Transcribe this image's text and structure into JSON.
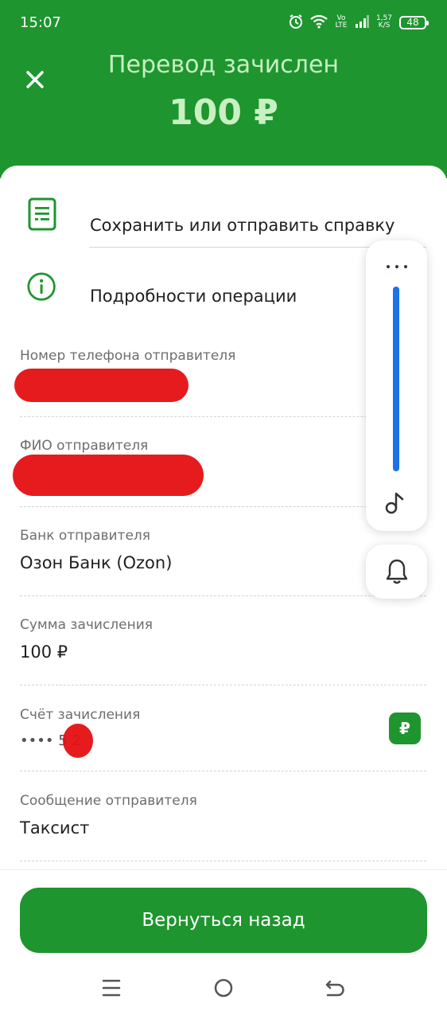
{
  "status_bar": {
    "time": "15:07",
    "volte_label": "Vo LTE",
    "speed_value": "1,57",
    "speed_unit": "K/S",
    "battery": "48"
  },
  "header": {
    "title": "Перевод зачислен",
    "amount": "100 ₽"
  },
  "actions": [
    {
      "label": "Сохранить или отправить справку",
      "icon": "document-icon"
    },
    {
      "label": "Подробности операции",
      "icon": "info-icon"
    }
  ],
  "details": {
    "sender_phone": {
      "label": "Номер телефона отправителя",
      "value": ""
    },
    "sender_name": {
      "label": "ФИО отправителя",
      "value": ""
    },
    "sender_bank": {
      "label": "Банк отправителя",
      "value": "Озон Банк (Ozon)"
    },
    "credit_amount": {
      "label": "Сумма зачисления",
      "value": "100 ₽"
    },
    "credit_account": {
      "label": "Счёт зачисления",
      "value": "•••• 5 2",
      "badge": "₽"
    },
    "sender_message": {
      "label": "Сообщение отправителя",
      "value": "Таксист"
    }
  },
  "volume_panel": {
    "level": 1.0
  },
  "footer": {
    "back_button": "Вернуться назад"
  },
  "colors": {
    "brand_green": "#1e952f",
    "header_text": "#c8f0c2",
    "redaction": "#e50f12",
    "volume_accent": "#1a73e8"
  }
}
